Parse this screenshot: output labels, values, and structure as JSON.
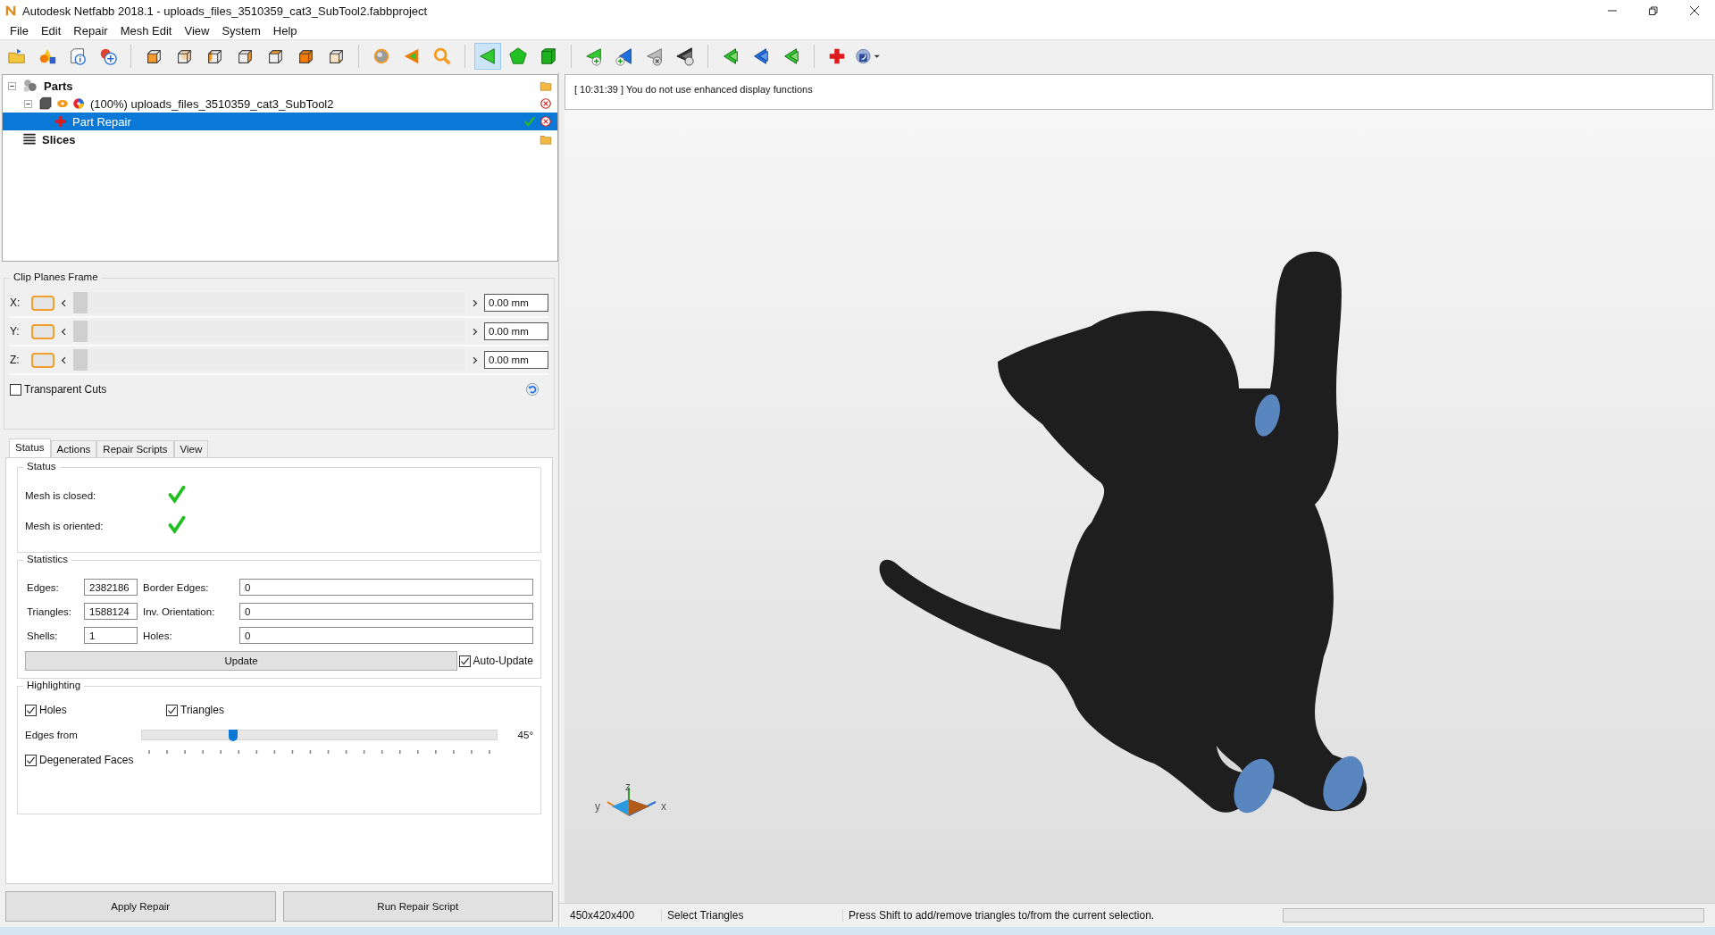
{
  "window": {
    "title": "Autodesk Netfabb 2018.1 - uploads_files_3510359_cat3_SubTool2.fabbproject"
  },
  "menu": [
    "File",
    "Edit",
    "Repair",
    "Mesh Edit",
    "View",
    "System",
    "Help"
  ],
  "toolbar": [
    {
      "kind": "open",
      "selected": false
    },
    {
      "kind": "shapes",
      "selected": false
    },
    {
      "kind": "info",
      "selected": false
    },
    {
      "kind": "add-part",
      "selected": false
    },
    {
      "kind": "separator"
    },
    {
      "kind": "cube-front",
      "selected": false
    },
    {
      "kind": "cube-back",
      "selected": false
    },
    {
      "kind": "cube-left",
      "selected": false
    },
    {
      "kind": "cube-right",
      "selected": false
    },
    {
      "kind": "cube-top",
      "selected": false
    },
    {
      "kind": "cube-solid",
      "selected": false
    },
    {
      "kind": "cube-bottom",
      "selected": false
    },
    {
      "kind": "separator"
    },
    {
      "kind": "sphere",
      "selected": false
    },
    {
      "kind": "arrow",
      "selected": false
    },
    {
      "kind": "zoom",
      "selected": false
    },
    {
      "kind": "separator"
    },
    {
      "kind": "triangle",
      "selected": true
    },
    {
      "kind": "pentagon",
      "selected": false
    },
    {
      "kind": "shell",
      "selected": false
    },
    {
      "kind": "separator"
    },
    {
      "kind": "add-triangle",
      "selected": false
    },
    {
      "kind": "add-blue",
      "selected": false
    },
    {
      "kind": "remove",
      "selected": false
    },
    {
      "kind": "remove-dark",
      "selected": false
    },
    {
      "kind": "separator"
    },
    {
      "kind": "flip-green",
      "selected": false
    },
    {
      "kind": "flip-blue",
      "selected": false
    },
    {
      "kind": "flip-green",
      "selected": false
    },
    {
      "kind": "separator"
    },
    {
      "kind": "repair",
      "selected": false
    },
    {
      "kind": "options",
      "selected": false
    }
  ],
  "tree": [
    {
      "kind": "parts",
      "label": "Parts",
      "expanded": true,
      "selected": false,
      "children": [
        {
          "kind": "part",
          "label": "(100%) uploads_files_3510359_cat3_SubTool2",
          "expanded": true,
          "selected": false,
          "children": [
            {
              "kind": "repair",
              "label": "Part Repair",
              "selected": true
            }
          ]
        }
      ]
    },
    {
      "kind": "slices",
      "label": "Slices",
      "selected": false
    }
  ],
  "log": "[ 10:31:39 ] You do not use enhanced display functions",
  "clip_planes": {
    "title": "Clip Planes Frame",
    "planes": [
      {
        "axis": "X:",
        "on": false,
        "level": 0,
        "value": "0.00 mm"
      },
      {
        "axis": "Y:",
        "on": false,
        "level": 0,
        "value": "0.00 mm"
      },
      {
        "axis": "Z:",
        "on": false,
        "level": 0,
        "value": "0.00 mm"
      }
    ],
    "transparent_cuts": {
      "label": "Transparent Cuts",
      "checked": false
    }
  },
  "tabs": [
    {
      "label": "Status",
      "selected": true
    },
    {
      "label": "Actions",
      "selected": false
    },
    {
      "label": "Repair Scripts",
      "selected": false
    },
    {
      "label": "View",
      "selected": false
    }
  ],
  "status": {
    "title": "Status",
    "items": [
      {
        "label": "Mesh is closed:",
        "ok": true
      },
      {
        "label": "Mesh is oriented:",
        "ok": true
      }
    ]
  },
  "statistics": {
    "title": "Statistics",
    "fields": [
      {
        "label": "Edges:",
        "value": "2382186"
      },
      {
        "label": "Border Edges:",
        "value": "0"
      },
      {
        "label": "Triangles:",
        "value": "1588124"
      },
      {
        "label": "Inv. Orientation:",
        "value": "0"
      },
      {
        "label": "Shells:",
        "value": "1"
      },
      {
        "label": "Holes:",
        "value": "0"
      }
    ],
    "update_button": "Update",
    "auto_update": {
      "label": "Auto-Update",
      "checked": true
    }
  },
  "highlighting": {
    "title": "Highlighting",
    "holes": {
      "label": "Holes",
      "checked": true
    },
    "triangles": {
      "label": "Triangles",
      "checked": true
    },
    "edges_from": {
      "label": "Edges from",
      "level": 0.25,
      "reading": "45°"
    },
    "degenerated_faces": {
      "label": "Degenerated Faces",
      "checked": true
    }
  },
  "buttons": [
    "Apply Repair",
    "Run Repair Script"
  ],
  "axes": {
    "x": "x",
    "y": "y",
    "z": "z"
  },
  "status_bar": {
    "cells": [
      "450x420x400",
      "Select Triangles",
      "Press Shift to add/remove triangles to/from the current selection."
    ],
    "progress": {
      "level": 0
    }
  }
}
